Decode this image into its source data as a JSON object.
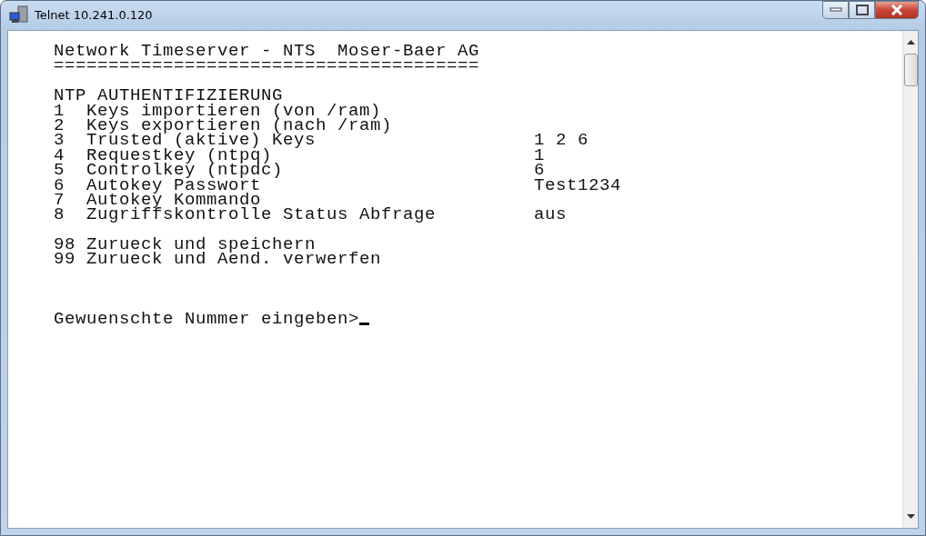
{
  "window": {
    "title": "Telnet 10.241.0.120"
  },
  "terminal": {
    "header": "Network Timeserver - NTS  Moser-Baer AG",
    "separator": "=======================================",
    "section_title": "NTP AUTHENTIFIZIERUNG",
    "menu_items": [
      {
        "number": "1",
        "label": "Keys importieren (von /ram)"
      },
      {
        "number": "2",
        "label": "Keys exportieren (nach /ram)"
      },
      {
        "number": "3",
        "label": "Trusted (aktive) Keys",
        "value": "1 2 6"
      },
      {
        "number": "4",
        "label": "Requestkey (ntpq)",
        "value": "1"
      },
      {
        "number": "5",
        "label": "Controlkey (ntpdc)",
        "value": "6"
      },
      {
        "number": "6",
        "label": "Autokey Passwort",
        "value": "Test1234"
      },
      {
        "number": "7",
        "label": "Autokey Kommando"
      },
      {
        "number": "8",
        "label": "Zugriffskontrolle Status Abfrage",
        "value": "aus"
      }
    ],
    "actions": [
      {
        "number": "98",
        "label": "Zurueck und speichern"
      },
      {
        "number": "99",
        "label": "Zurueck und Aend. verwerfen"
      }
    ],
    "prompt": "Gewuenschte Nummer eingeben>"
  }
}
